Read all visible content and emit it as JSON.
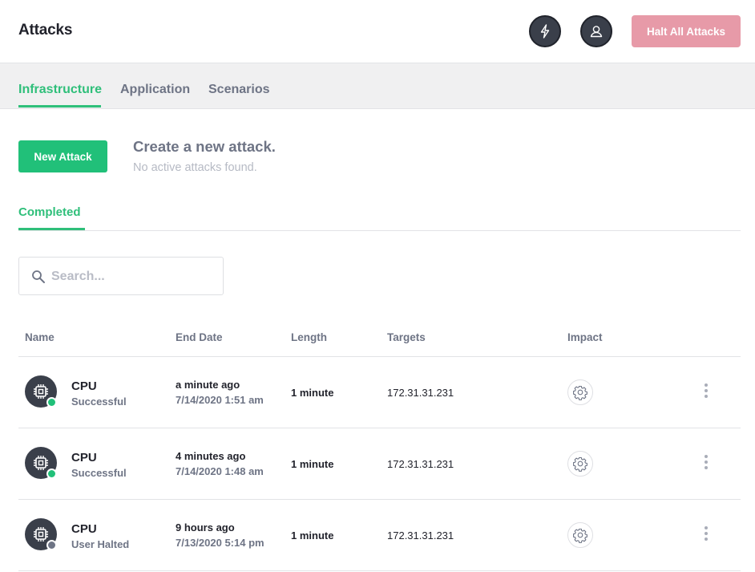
{
  "header": {
    "title": "Attacks",
    "halt_button": "Halt All Attacks",
    "halt_color": "#e79aa8"
  },
  "tabs": [
    {
      "label": "Infrastructure",
      "active": true
    },
    {
      "label": "Application",
      "active": false
    },
    {
      "label": "Scenarios",
      "active": false
    }
  ],
  "create": {
    "button": "New Attack",
    "title": "Create a new attack.",
    "subtitle": "No active attacks found."
  },
  "subtabs": [
    {
      "label": "Completed",
      "active": true
    }
  ],
  "search": {
    "placeholder": "Search...",
    "value": ""
  },
  "table": {
    "columns": [
      "Name",
      "End Date",
      "Length",
      "Targets",
      "Impact"
    ],
    "rows": [
      {
        "name": "CPU",
        "status": "Successful",
        "status_kind": "ok",
        "relative": "a minute ago",
        "end_date": "7/14/2020 1:51 am",
        "length": "1 minute",
        "target": "172.31.31.231"
      },
      {
        "name": "CPU",
        "status": "Successful",
        "status_kind": "ok",
        "relative": "4 minutes ago",
        "end_date": "7/14/2020 1:48 am",
        "length": "1 minute",
        "target": "172.31.31.231"
      },
      {
        "name": "CPU",
        "status": "User Halted",
        "status_kind": "halted",
        "relative": "9 hours ago",
        "end_date": "7/13/2020 5:14 pm",
        "length": "1 minute",
        "target": "172.31.31.231"
      }
    ]
  },
  "icons": {
    "header_left": "lightning-bolt-icon",
    "header_right": "user-icon",
    "row": "cpu-chip-icon",
    "impact": "gear-icon",
    "menu": "kebab-menu-icon",
    "search": "search-icon"
  },
  "colors": {
    "accent": "#2fbf7a",
    "primary_button": "#21c079",
    "dark": "#3a3f4a",
    "status_ok": "#21c079",
    "status_halted": "#6e7485"
  }
}
